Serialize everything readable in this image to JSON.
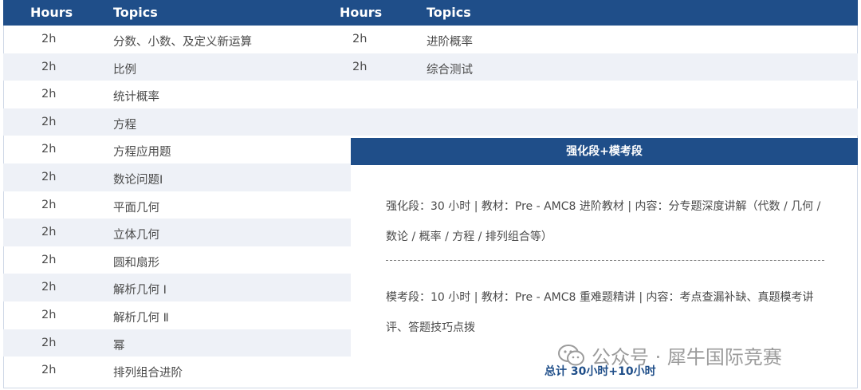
{
  "left_table": {
    "headers": [
      "Hours",
      "Topics"
    ],
    "rows": [
      {
        "hours": "2h",
        "topic": "分数、小数、及定义新运算"
      },
      {
        "hours": "2h",
        "topic": "比例"
      },
      {
        "hours": "2h",
        "topic": "统计概率"
      },
      {
        "hours": "2h",
        "topic": "方程"
      },
      {
        "hours": "2h",
        "topic": "方程应用题"
      },
      {
        "hours": "2h",
        "topic": "数论问题I"
      },
      {
        "hours": "2h",
        "topic": "平面几何"
      },
      {
        "hours": "2h",
        "topic": "立体几何"
      },
      {
        "hours": "2h",
        "topic": "圆和扇形"
      },
      {
        "hours": "2h",
        "topic": "解析几何 Ⅰ"
      },
      {
        "hours": "2h",
        "topic": "解析几何 Ⅱ"
      },
      {
        "hours": "2h",
        "topic": "幂"
      },
      {
        "hours": "2h",
        "topic": "排列组合进阶"
      }
    ]
  },
  "right_table": {
    "headers": [
      "Hours",
      "Topics"
    ],
    "rows": [
      {
        "hours": "2h",
        "topic": "进阶概率"
      },
      {
        "hours": "2h",
        "topic": "综合测试"
      }
    ]
  },
  "section": {
    "title": "强化段+模考段",
    "para1": "强化段：30 小时 | 教材：Pre - AMC8 进阶教材 | 内容：分专题深度讲解（代数 / 几何 / 数论 / 概率 / 方程 / 排列组合等）",
    "para2": "模考段：10 小时 | 教材：Pre - AMC8 重难题精讲 | 内容：考点查漏补缺、真题模考讲评、答题技巧点拨",
    "total": "总计 30小时+10小时"
  },
  "watermark": {
    "text": "公众号 · 犀牛国际竞赛",
    "icon": "wechat-icon"
  },
  "colors": {
    "header": "#1f4e89",
    "alt_row": "#eef1f7"
  }
}
